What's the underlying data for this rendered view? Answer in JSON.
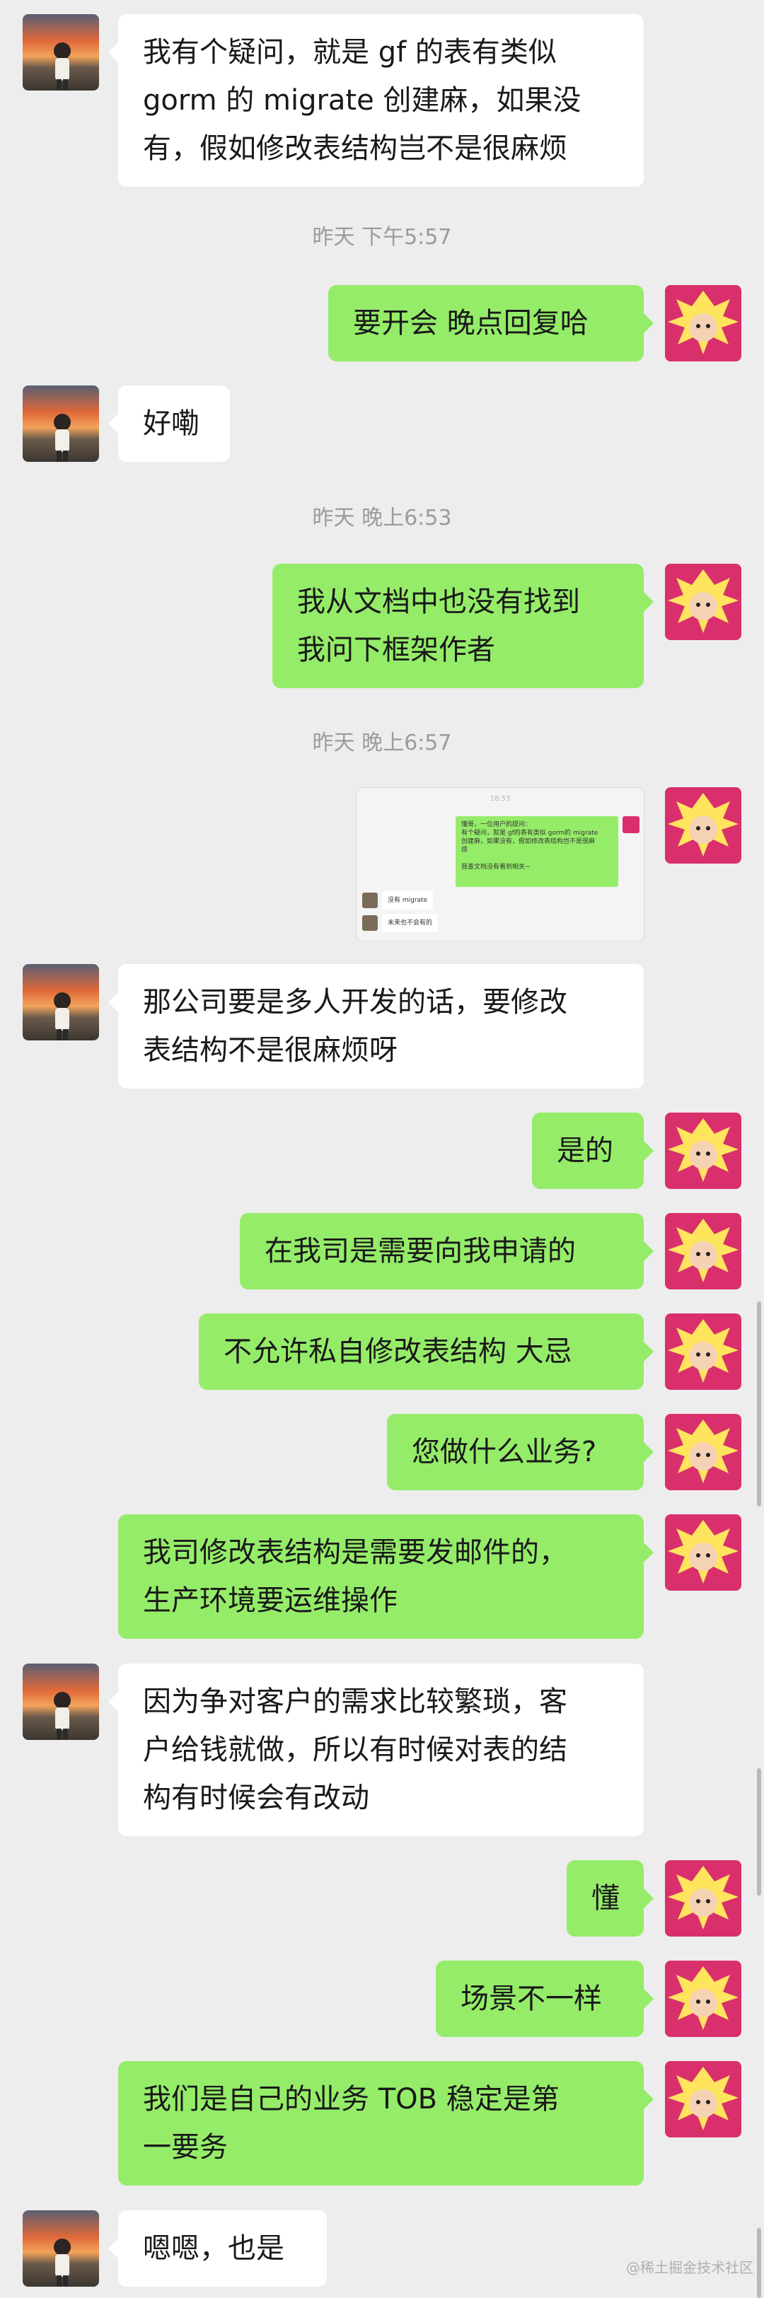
{
  "timestamps": [
    "昨天 下午5:57",
    "昨天 晚上6:53",
    "昨天 晚上6:57"
  ],
  "messages": [
    {
      "lines": [
        "我有个疑问，就是 gf 的表有类似",
        "gorm 的 migrate 创建麻，如果没",
        "有，假如修改表结构岂不是很麻烦"
      ]
    },
    {
      "lines": [
        "要开会 晚点回复哈"
      ]
    },
    {
      "lines": [
        "好嘞"
      ]
    },
    {
      "lines": [
        "我从文档中也没有找到",
        "我问下框架作者"
      ]
    },
    {
      "lines": [
        "那公司要是多人开发的话，要修改",
        "表结构不是很麻烦呀"
      ]
    },
    {
      "lines": [
        "是的"
      ]
    },
    {
      "lines": [
        "在我司是需要向我申请的"
      ]
    },
    {
      "lines": [
        "不允许私自修改表结构 大忌"
      ]
    },
    {
      "lines": [
        "您做什么业务?"
      ]
    },
    {
      "lines": [
        "我司修改表结构是需要发邮件的，",
        "生产环境要运维操作"
      ]
    },
    {
      "lines": [
        "因为争对客户的需求比较繁琐，客",
        "户给钱就做，所以有时候对表的结",
        "构有时候会有改动"
      ]
    },
    {
      "lines": [
        "懂"
      ]
    },
    {
      "lines": [
        "场景不一样"
      ]
    },
    {
      "lines": [
        "我们是自己的业务 TOB 稳定是第",
        "一要务"
      ]
    },
    {
      "lines": [
        "嗯嗯，也是"
      ]
    }
  ],
  "image_message": {
    "time": "18:53",
    "quote_lines": [
      "懂哥，一位用户的提问：",
      "有个疑问，就是 gf的表有类似 gorm的 migrate",
      "创建麻，如果没有，假如修改表结构岂不是很麻",
      "烦",
      "",
      "我查文档没有看到相关~"
    ],
    "replies": [
      "没有 migrate",
      "未来也不会有的"
    ]
  },
  "watermark": "@稀土掘金技术社区",
  "colors": {
    "outgoing": "#95ec69",
    "incoming": "#ffffff",
    "background": "#ededed"
  }
}
